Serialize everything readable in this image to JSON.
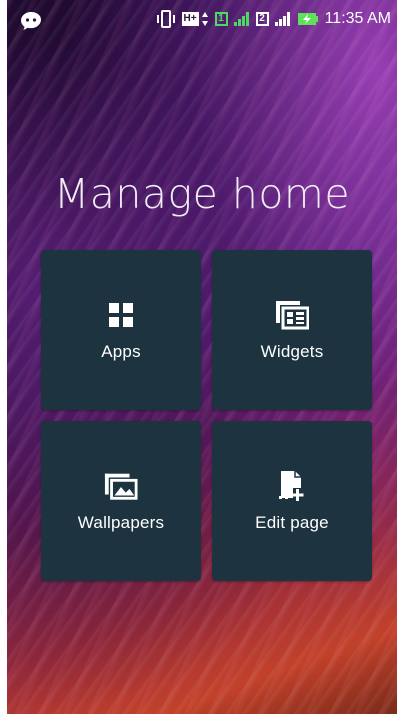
{
  "status_bar": {
    "time": "11:35 AM",
    "network_type": "H+",
    "sim1": "1",
    "sim2": "2",
    "icons": [
      "chat-bubble-icon",
      "vibrate-icon",
      "hplus-data-icon",
      "sim1-icon",
      "signal-icon",
      "sim2-icon",
      "signal-icon",
      "battery-charging-icon"
    ]
  },
  "page": {
    "title": "Manage home"
  },
  "tiles": [
    {
      "label": "Apps",
      "icon": "apps-grid-icon"
    },
    {
      "label": "Widgets",
      "icon": "widgets-icon"
    },
    {
      "label": "Wallpapers",
      "icon": "wallpapers-icon"
    },
    {
      "label": "Edit page",
      "icon": "edit-page-icon"
    }
  ],
  "colors": {
    "tile_bg": "#1d3440",
    "sim_green": "#4cd964",
    "battery_green": "#5ee05a"
  }
}
